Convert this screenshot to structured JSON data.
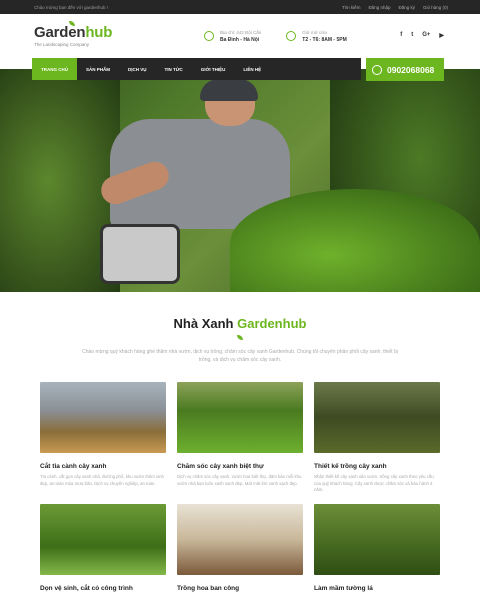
{
  "topbar": {
    "welcome": "Chào mừng bạn đến với gardenhub !",
    "links": [
      "Tìm kiếm",
      "Đăng nhập",
      "Đăng ký",
      "Giỏ hàng (0)"
    ]
  },
  "logo": {
    "part1": "Garden",
    "part2": "hub",
    "tagline": "The Landscaping Company"
  },
  "address": {
    "label": "Địa chỉ: 442 Đội Cấn",
    "value": "Ba Đình - Hà Nội"
  },
  "hours": {
    "label": "Giờ mở cửa",
    "value": "T2 - T6: 8AM - 5PM"
  },
  "social": [
    "f",
    "t",
    "G+",
    "▶"
  ],
  "nav": [
    "TRANG CHỦ",
    "SẢN PHẨM",
    "DỊCH VỤ",
    "TIN TỨC",
    "GIỚI THIỆU",
    "LIÊN HỆ"
  ],
  "hotline": "0902068068",
  "section": {
    "title1": "Nhà Xanh ",
    "title2": "Gardenhub",
    "desc": "Chào mừng quý khách hàng ghé thăm nhà vườn, dịch vụ trồng, chăm sóc cây xanh Gardenhub. Chúng tôi chuyên phân phối cây xanh, thiết bị trồng, và dịch vụ chăm sóc cây xanh."
  },
  "cards": [
    {
      "title": "Cắt tỉa cành cây xanh",
      "desc": "Tỉa cành, cắt gọn cây xanh nhà, đường phố, khu vườn thêm xinh đẹp, an toàn mùa mưa bão. Dịch vụ chuyên nghiệp, an toàn."
    },
    {
      "title": "Chăm sóc cây xanh biệt thự",
      "desc": "Dịch vụ chăm sóc cây xanh, vườn hoa biệt thự, đảm bảo mỗi khu vườn nhà bạn luôn xanh sạch đẹp. Mát mát êm xanh sạch đẹp."
    },
    {
      "title": "Thiết kế trồng cây xanh",
      "desc": "Nhận thiết kế cây xanh sân vườn, trồng cây xanh theo yêu cầu của quý khách hàng. Cây xanh được chăm sóc và bảo hành 3 năm."
    },
    {
      "title": "Dọn vệ sinh, cắt cỏ công trình",
      "desc": ""
    },
    {
      "title": "Trồng hoa ban công",
      "desc": ""
    },
    {
      "title": "Làm mầm tường lá",
      "desc": ""
    }
  ]
}
